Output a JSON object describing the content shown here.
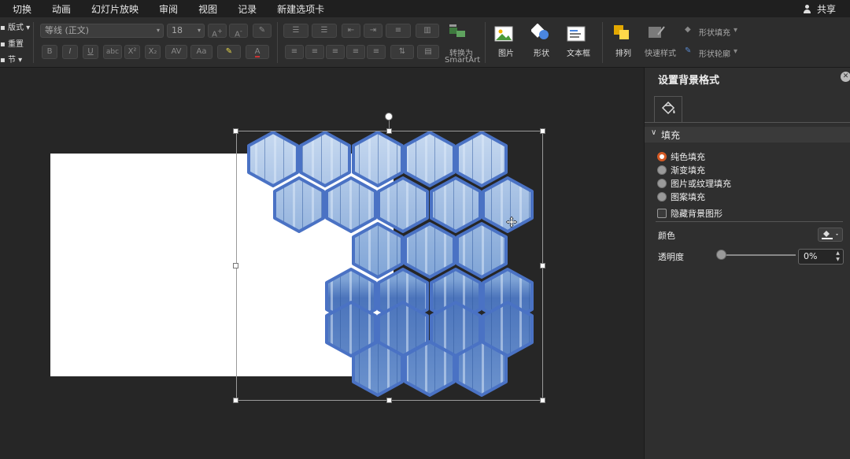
{
  "menu_tabs": [
    "切换",
    "动画",
    "幻灯片放映",
    "审阅",
    "视图",
    "记录",
    "新建选项卡"
  ],
  "share_label": "共享",
  "ribbon": {
    "layout_label": "版式",
    "reset_label": "重置",
    "section_label": "节",
    "font_name": "等线 (正文)",
    "font_size": "18",
    "convert_smartart_label_1": "转换为",
    "convert_smartart_label_2": "SmartArt",
    "picture_label": "图片",
    "shape_label": "形状",
    "textbox_label": "文本框",
    "arrange_label": "排列",
    "quick_styles_label": "快速样式",
    "shape_fill_label": "形状填充",
    "shape_outline_label": "形状轮廓"
  },
  "panel": {
    "title": "设置背景格式",
    "section_fill": "填充",
    "options": [
      "纯色填充",
      "渐变填充",
      "图片或纹理填充",
      "图案填充"
    ],
    "selected_option": "纯色填充",
    "hide_bg_graphics": "隐藏背景图形",
    "color_label": "颜色",
    "transparency_label": "透明度",
    "transparency_value": "0%"
  },
  "colors": {
    "accent_radio": "#d45a25",
    "hex_stroke": "#4a72c4",
    "slide_bg": "#ffffff"
  },
  "icons": [
    "share-icon",
    "paint-bucket-icon",
    "picture-icon",
    "shape-icon",
    "textbox-icon",
    "arrange-icon",
    "quick-styles-icon",
    "close-icon",
    "move-cursor-icon"
  ]
}
